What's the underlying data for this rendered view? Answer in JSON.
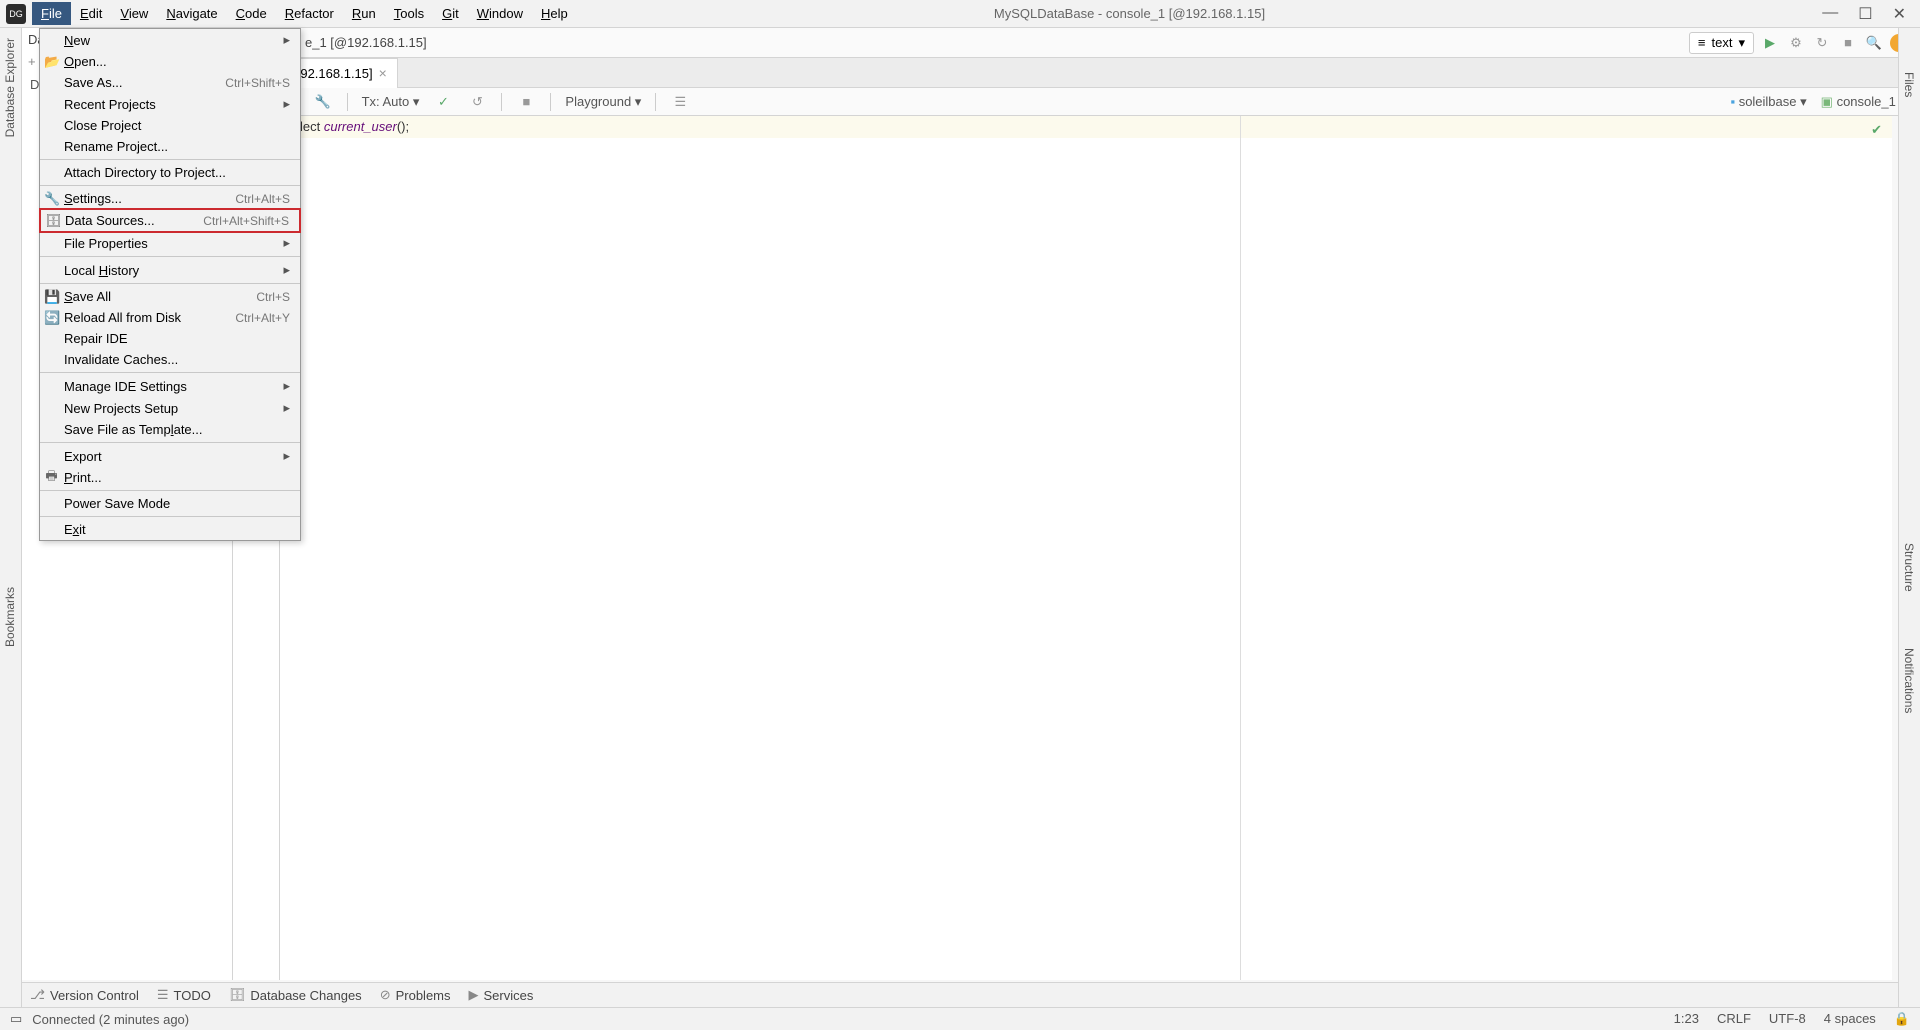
{
  "menubar": {
    "items": [
      "File",
      "Edit",
      "View",
      "Navigate",
      "Code",
      "Refactor",
      "Run",
      "Tools",
      "Git",
      "Window",
      "Help"
    ],
    "active_index": 0
  },
  "window_title": "MySQLDataBase - console_1 [@192.168.1.15]",
  "breadcrumb_partial": "e_1 [@192.168.1.15]",
  "nav_dropdown": {
    "icon": "align-left-icon",
    "label": "text"
  },
  "tab": {
    "label_partial": "e_1 [@192.168.1.15]"
  },
  "editor_toolbar": {
    "tx": "Tx: Auto",
    "playground": "Playground",
    "db": "soleilbase",
    "console": "console_1"
  },
  "editor": {
    "line1_prefix": "lect ",
    "line1_fn": "current_user",
    "line1_suffix": "();"
  },
  "sidebar_left": {
    "database_explorer": "Database Explorer",
    "bookmarks": "Bookmarks"
  },
  "sidebar_right": {
    "files": "Files",
    "structure": "Structure",
    "notifications": "Notifications"
  },
  "panel_header": "Dat",
  "file_menu": [
    {
      "label": "New",
      "underline": 0,
      "arrow": true
    },
    {
      "label": "Open...",
      "underline": 0,
      "icon": "folder-open-icon"
    },
    {
      "label": "Save As...",
      "shortcut": "Ctrl+Shift+S"
    },
    {
      "label": "Recent Projects",
      "arrow": true
    },
    {
      "label": "Close Project"
    },
    {
      "label": "Rename Project..."
    },
    {
      "sep": true
    },
    {
      "label": "Attach Directory to Project..."
    },
    {
      "sep": true
    },
    {
      "label": "Settings...",
      "underline": 0,
      "shortcut": "Ctrl+Alt+S",
      "icon": "wrench-icon"
    },
    {
      "label": "Data Sources...",
      "shortcut": "Ctrl+Alt+Shift+S",
      "icon": "datasource-icon",
      "highlight": true
    },
    {
      "label": "File Properties",
      "arrow": true
    },
    {
      "sep": true
    },
    {
      "label": "Local History",
      "underline": 6,
      "arrow": true
    },
    {
      "sep": true
    },
    {
      "label": "Save All",
      "underline": 0,
      "shortcut": "Ctrl+S",
      "icon": "save-icon"
    },
    {
      "label": "Reload All from Disk",
      "shortcut": "Ctrl+Alt+Y",
      "icon": "reload-icon"
    },
    {
      "label": "Repair IDE"
    },
    {
      "label": "Invalidate Caches..."
    },
    {
      "sep": true
    },
    {
      "label": "Manage IDE Settings",
      "arrow": true
    },
    {
      "label": "New Projects Setup",
      "arrow": true
    },
    {
      "label": "Save File as Template...",
      "underline": 17
    },
    {
      "sep": true
    },
    {
      "label": "Export",
      "arrow": true
    },
    {
      "label": "Print...",
      "underline": 0,
      "icon": "print-icon"
    },
    {
      "sep": true
    },
    {
      "label": "Power Save Mode"
    },
    {
      "sep": true
    },
    {
      "label": "Exit",
      "underline": 1
    }
  ],
  "bottom_tabs": [
    {
      "icon": "branch-icon",
      "label": "Version Control"
    },
    {
      "icon": "todo-icon",
      "label": "TODO"
    },
    {
      "icon": "db-changes-icon",
      "label": "Database Changes"
    },
    {
      "icon": "problems-icon",
      "label": "Problems"
    },
    {
      "icon": "services-icon",
      "label": "Services"
    }
  ],
  "statusbar": {
    "left": "Connected (2 minutes ago)",
    "linecol": "1:23",
    "lineend": "CRLF",
    "encoding": "UTF-8",
    "indent": "4 spaces"
  }
}
